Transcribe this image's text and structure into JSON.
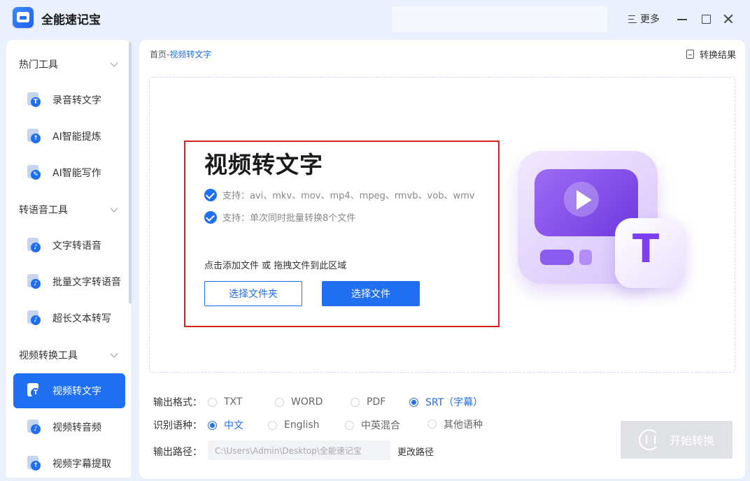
{
  "app": {
    "title": "全能速记宝"
  },
  "titlebar": {
    "more_label": "更多"
  },
  "sidebar": {
    "groups": [
      {
        "label": "热门工具"
      },
      {
        "label": "转语音工具"
      },
      {
        "label": "视频转换工具"
      }
    ],
    "items": [
      {
        "label": "录音转文字",
        "icon": "record-to-text-icon"
      },
      {
        "label": "AI智能提炼",
        "icon": "ai-extract-icon"
      },
      {
        "label": "AI智能写作",
        "icon": "ai-writing-icon"
      },
      {
        "label": "文字转语音",
        "icon": "text-to-speech-icon"
      },
      {
        "label": "批量文字转语音",
        "icon": "batch-text-to-speech-icon"
      },
      {
        "label": "超长文本转写",
        "icon": "long-text-icon"
      },
      {
        "label": "视频转文字",
        "icon": "video-to-text-icon",
        "active": true
      },
      {
        "label": "视频转音频",
        "icon": "video-to-audio-icon"
      },
      {
        "label": "视频字幕提取",
        "icon": "subtitle-extract-icon"
      }
    ]
  },
  "main": {
    "breadcrumb_home": "首页",
    "breadcrumb_sep": "-",
    "breadcrumb_current": "视频转文字",
    "result_link": "转换结果",
    "feature_title": "视频转文字",
    "support_formats": "支持：avi、mkv、mov、mp4、mpeg、rmvb、vob、wmv",
    "support_batch": "支持：单次同时批量转换8个文件",
    "hint": "点击添加文件 或 拖拽文件到此区域",
    "btn_folder": "选择文件夹",
    "btn_file": "选择文件"
  },
  "options": {
    "format_label": "输出格式：",
    "formats": [
      {
        "label": "TXT",
        "selected": false
      },
      {
        "label": "WORD",
        "selected": false
      },
      {
        "label": "PDF",
        "selected": false
      },
      {
        "label": "SRT（字幕）",
        "selected": true
      }
    ],
    "language_label": "识别语种：",
    "languages": [
      {
        "label": "中文",
        "selected": true
      },
      {
        "label": "English",
        "selected": false
      },
      {
        "label": "中英混合",
        "selected": false
      },
      {
        "label": "其他语种",
        "selected": false
      }
    ],
    "path_label": "输出路径：",
    "path_value": "C:\\Users\\Admin\\Desktop\\全能速记宝",
    "change_path": "更改路径",
    "start_label": "开始转换"
  },
  "colors": {
    "accent": "#1f6ff0",
    "highlight": "#d42020",
    "disabled": "#dfe1e5"
  }
}
